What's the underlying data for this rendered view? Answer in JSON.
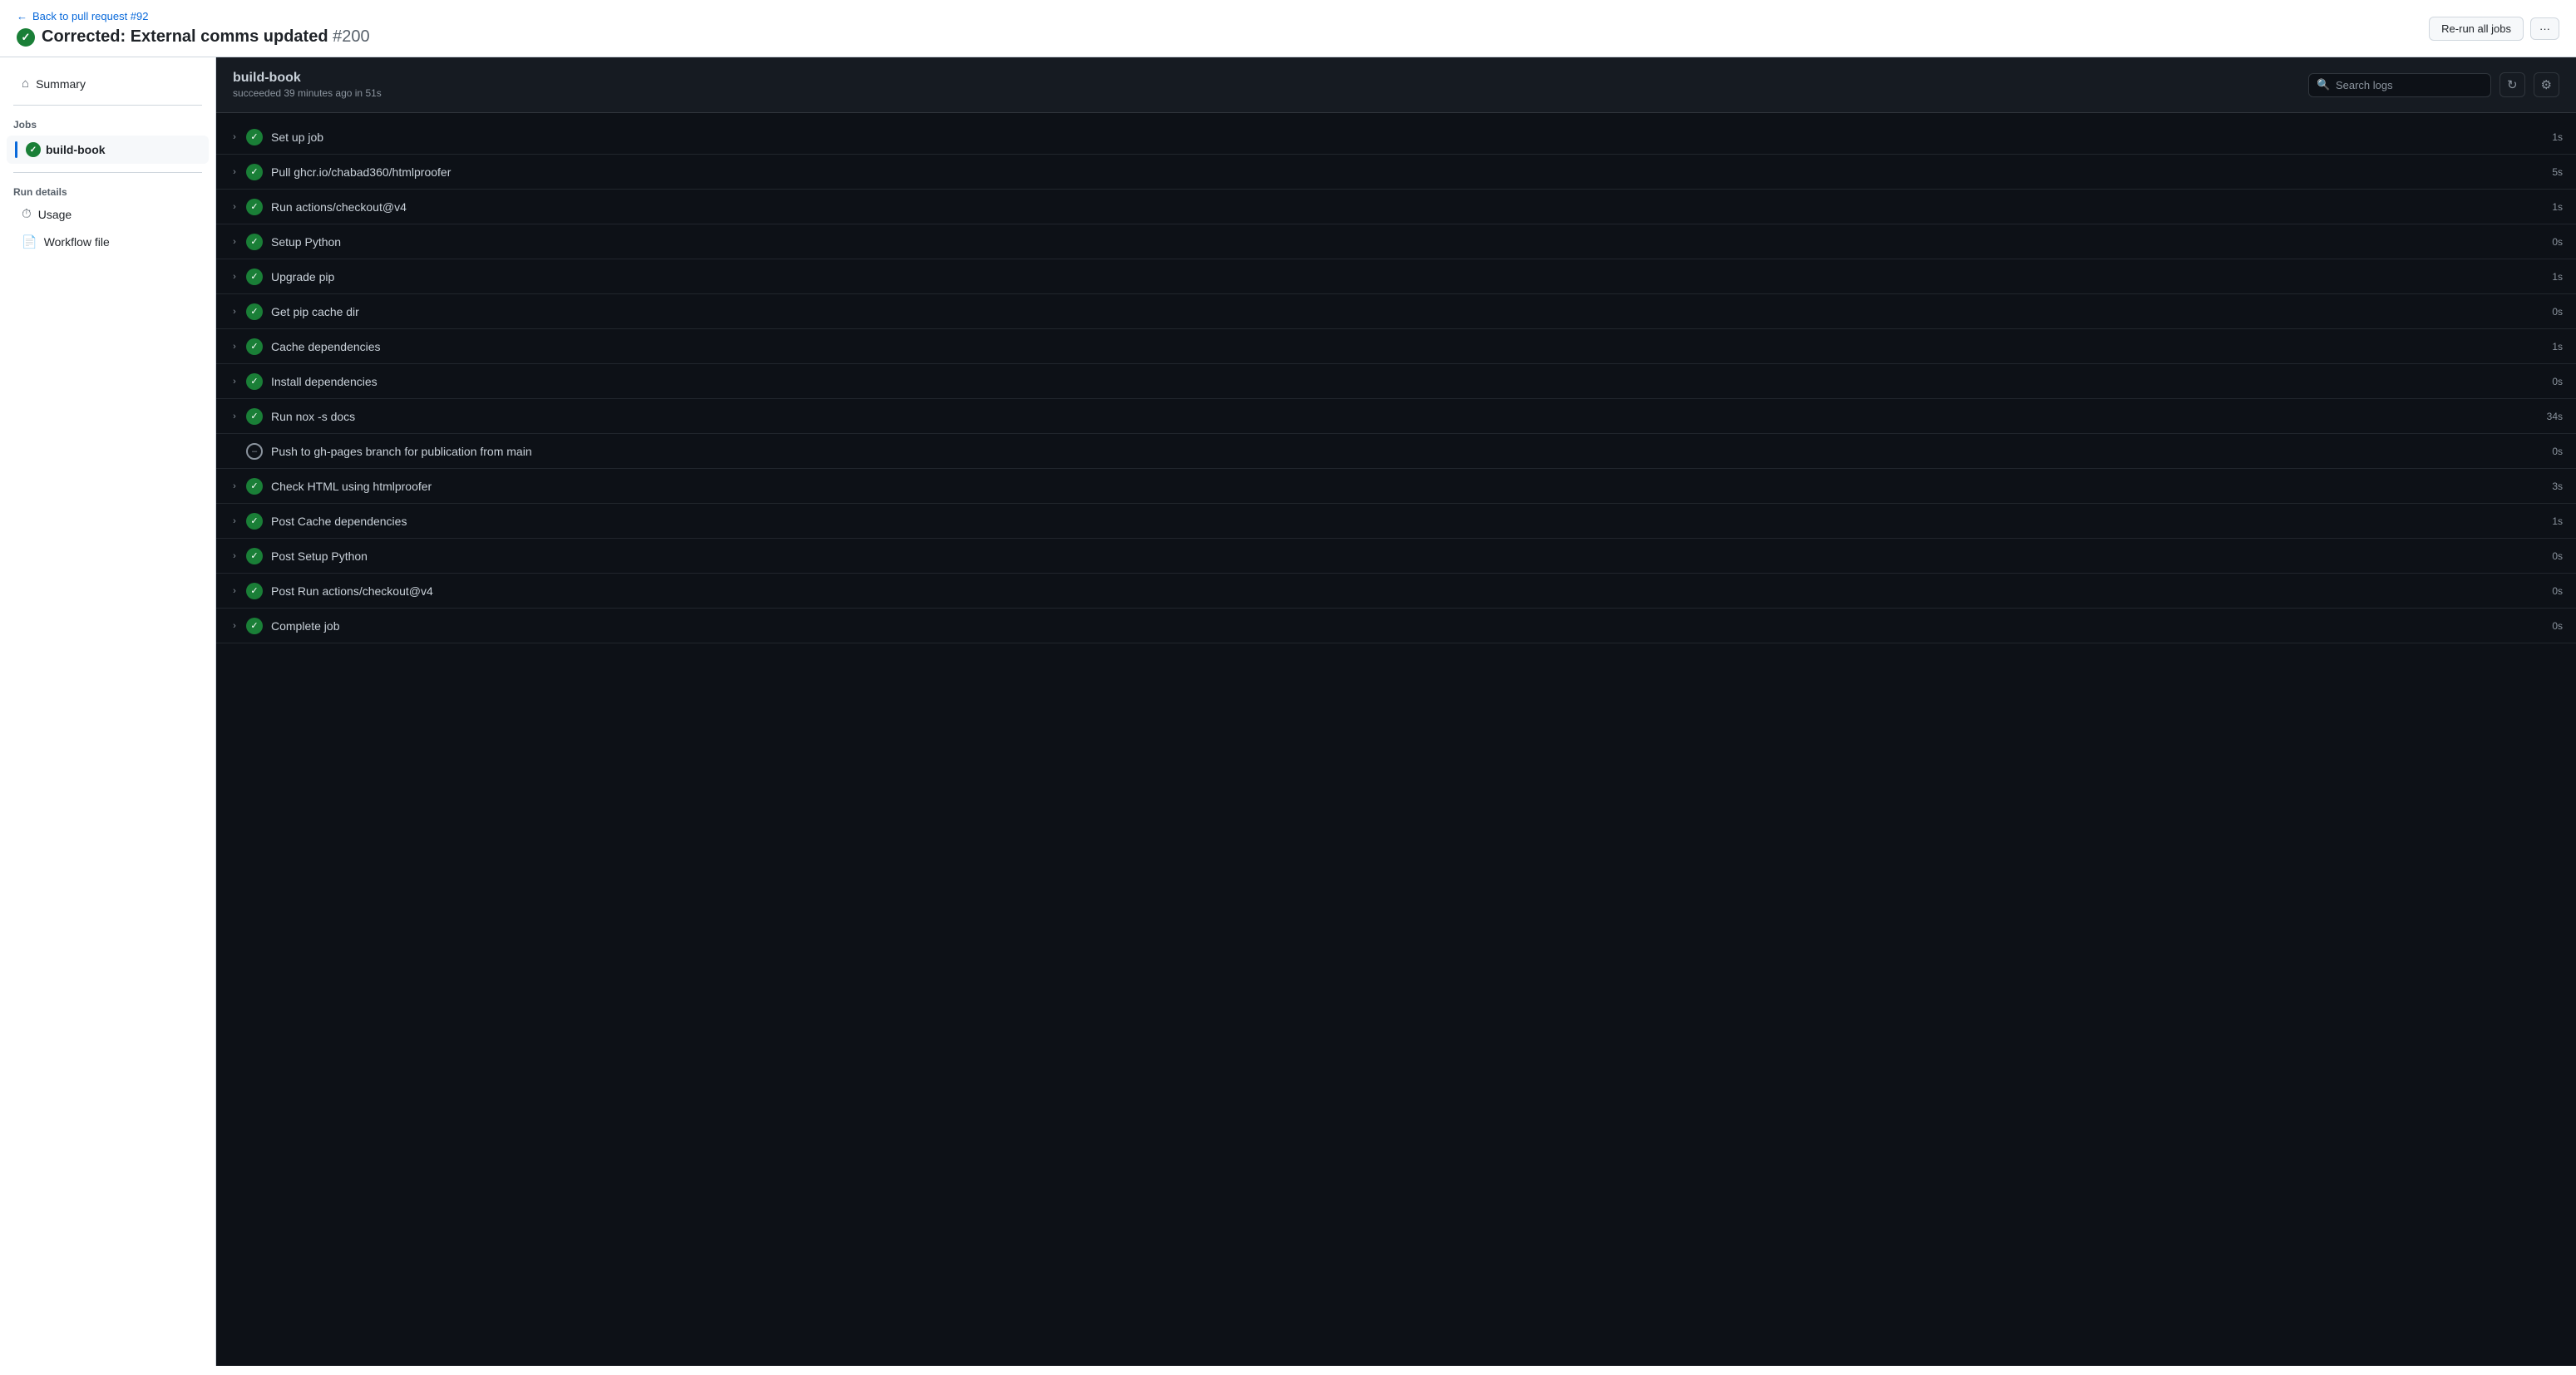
{
  "header": {
    "back_label": "Back to pull request #92",
    "title_prefix": "Corrected: External comms updated",
    "title_number": "#200",
    "rerun_label": "Re-run all jobs",
    "more_label": "···"
  },
  "sidebar": {
    "summary_label": "Summary",
    "jobs_section_label": "Jobs",
    "job_name": "build-book",
    "run_details_label": "Run details",
    "usage_label": "Usage",
    "workflow_file_label": "Workflow file"
  },
  "job_panel": {
    "job_title": "build-book",
    "job_meta": "succeeded 39 minutes ago in 51s",
    "search_placeholder": "Search logs",
    "steps": [
      {
        "name": "Set up job",
        "duration": "1s",
        "status": "success",
        "skipped": false
      },
      {
        "name": "Pull ghcr.io/chabad360/htmlproofer",
        "duration": "5s",
        "status": "success",
        "skipped": false
      },
      {
        "name": "Run actions/checkout@v4",
        "duration": "1s",
        "status": "success",
        "skipped": false
      },
      {
        "name": "Setup Python",
        "duration": "0s",
        "status": "success",
        "skipped": false
      },
      {
        "name": "Upgrade pip",
        "duration": "1s",
        "status": "success",
        "skipped": false
      },
      {
        "name": "Get pip cache dir",
        "duration": "0s",
        "status": "success",
        "skipped": false
      },
      {
        "name": "Cache dependencies",
        "duration": "1s",
        "status": "success",
        "skipped": false
      },
      {
        "name": "Install dependencies",
        "duration": "0s",
        "status": "success",
        "skipped": false
      },
      {
        "name": "Run nox -s docs",
        "duration": "34s",
        "status": "success",
        "skipped": false
      },
      {
        "name": "Push to gh-pages branch for publication from main",
        "duration": "0s",
        "status": "skipped",
        "skipped": true
      },
      {
        "name": "Check HTML using htmlproofer",
        "duration": "3s",
        "status": "success",
        "skipped": false
      },
      {
        "name": "Post Cache dependencies",
        "duration": "1s",
        "status": "success",
        "skipped": false
      },
      {
        "name": "Post Setup Python",
        "duration": "0s",
        "status": "success",
        "skipped": false
      },
      {
        "name": "Post Run actions/checkout@v4",
        "duration": "0s",
        "status": "success",
        "skipped": false
      },
      {
        "name": "Complete job",
        "duration": "0s",
        "status": "success",
        "skipped": false
      }
    ]
  }
}
